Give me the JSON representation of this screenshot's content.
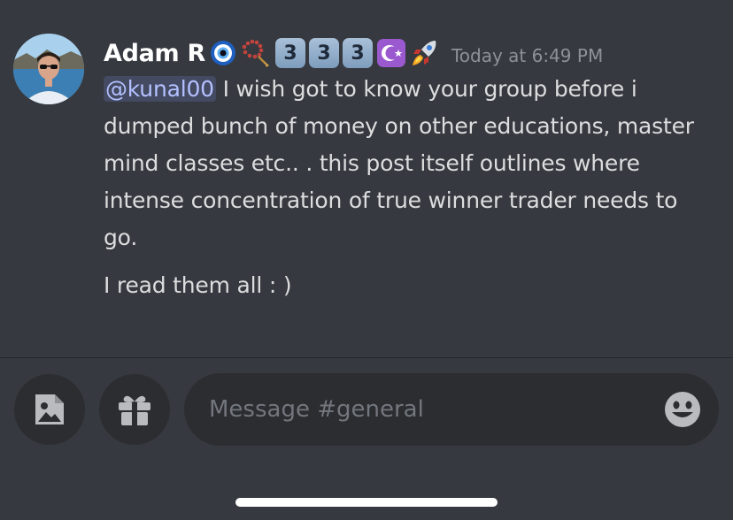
{
  "message": {
    "author": "Adam R",
    "badges": [
      {
        "icon": "nazar-amulet-icon"
      },
      {
        "icon": "prayer-beads-icon"
      },
      {
        "icon": "keycap-3-icon",
        "text": "3"
      },
      {
        "icon": "keycap-3-icon",
        "text": "3"
      },
      {
        "icon": "keycap-3-icon",
        "text": "3"
      },
      {
        "icon": "star-and-crescent-icon"
      },
      {
        "icon": "rocket-icon"
      }
    ],
    "timestamp": "Today at 6:49 PM",
    "mention": "@kunal00",
    "body_line1": " I wish got to know your group  before i dumped bunch of money on other educations, master mind classes etc.. . this post itself outlines where intense concentration of true  winner trader needs to go.",
    "body_line2": "I read them all : )"
  },
  "composer": {
    "placeholder": "Message #general",
    "value": "",
    "buttons": {
      "image": "image-icon",
      "gift": "gift-icon",
      "emoji": "emoji-icon"
    }
  },
  "colors": {
    "background": "#36393f",
    "input_background": "#2b2d31",
    "mention_text": "#b4c0ff",
    "timestamp": "#8e9297",
    "text": "#dcddde"
  }
}
